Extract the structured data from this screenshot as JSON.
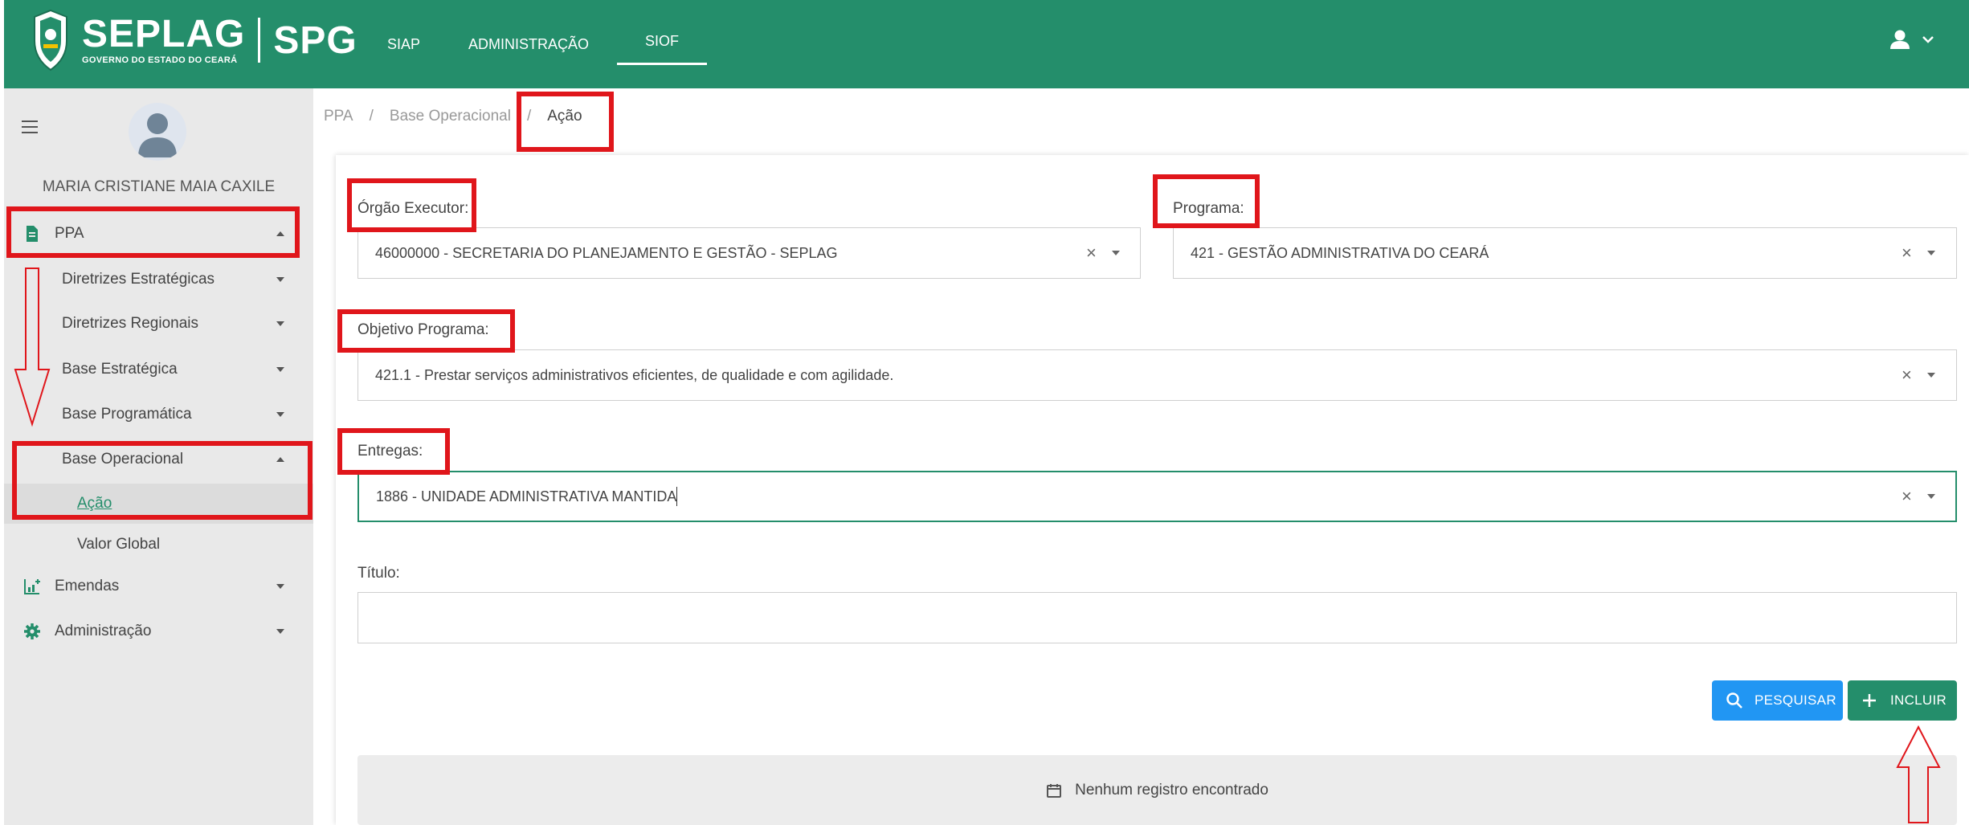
{
  "brand": {
    "name": "SEPLAG",
    "subtitle": "GOVERNO DO ESTADO DO CEARÁ",
    "system": "SPG"
  },
  "topnav": [
    {
      "label": "SIAP"
    },
    {
      "label": "ADMINISTRAÇÃO"
    },
    {
      "label": "SIOF",
      "active": true
    }
  ],
  "user": {
    "name": "MARIA CRISTIANE MAIA CAXILE"
  },
  "sidebar": {
    "items": [
      {
        "label": "PPA",
        "icon": "document-icon",
        "expanded": true
      },
      {
        "label": "Diretrizes Estratégicas"
      },
      {
        "label": "Diretrizes Regionais"
      },
      {
        "label": "Base Estratégica"
      },
      {
        "label": "Base Programática"
      },
      {
        "label": "Base Operacional",
        "expanded": true
      },
      {
        "label": "Ação",
        "selected": true
      },
      {
        "label": "Valor Global"
      },
      {
        "label": "Emendas",
        "icon": "chart-add-icon"
      },
      {
        "label": "Administração",
        "icon": "gear-icon"
      }
    ]
  },
  "breadcrumb": [
    "PPA",
    "/",
    "Base Operacional",
    "/",
    "Ação"
  ],
  "form": {
    "orgao": {
      "label": "Órgão Executor:",
      "value": "46000000 - SECRETARIA DO PLANEJAMENTO E GESTÃO - SEPLAG"
    },
    "programa": {
      "label": "Programa:",
      "value": "421 - GESTÃO ADMINISTRATIVA DO CEARÁ"
    },
    "objetivo": {
      "label": "Objetivo Programa:",
      "value": "421.1 - Prestar serviços administrativos eficientes, de qualidade e com agilidade."
    },
    "entregas": {
      "label": "Entregas:",
      "value": "1886 - UNIDADE ADMINISTRATIVA MANTIDA"
    },
    "titulo": {
      "label": "Título:",
      "value": ""
    },
    "clear_glyph": "×"
  },
  "buttons": {
    "search": "PESQUISAR",
    "add": "INCLUIR"
  },
  "empty_message": "Nenhum registro encontrado",
  "colors": {
    "primary": "#248e6b",
    "search": "#2196f3",
    "annotation": "#e0161b"
  }
}
